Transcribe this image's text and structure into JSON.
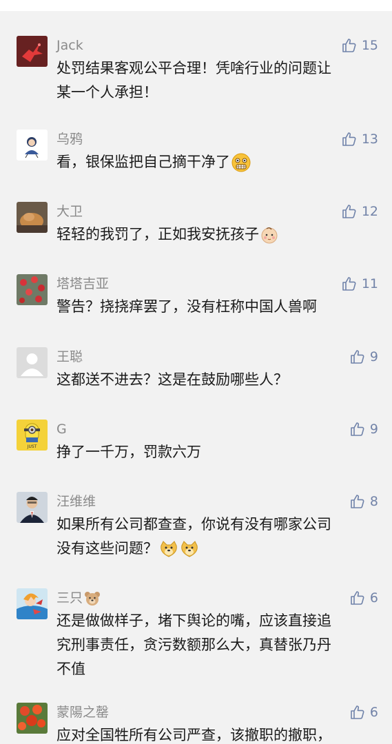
{
  "comments": [
    {
      "author": "Jack",
      "likes": "15",
      "lines": [
        "处罚结果客观公平合理！凭啥行业的问题让",
        "某一个人承担！"
      ],
      "avatar": "red-bird-avatar"
    },
    {
      "author": "乌鸦",
      "likes": "13",
      "lines": [
        "看，银保监把自己摘干净了"
      ],
      "emoji": "grimace-emoji",
      "avatar": "cartoon-person-avatar"
    },
    {
      "author": "大卫",
      "likes": "12",
      "lines": [
        "轻轻的我罚了，正如我安抚孩子"
      ],
      "emoji": "baby-emoji",
      "avatar": "cat-avatar"
    },
    {
      "author": "塔塔吉亚",
      "likes": "11",
      "lines": [
        "警告？挠挠痒罢了，没有枉称中国人兽啊"
      ],
      "avatar": "flowers-avatar"
    },
    {
      "author": "王聪",
      "likes": "9",
      "lines": [
        "这都送不进去？这是在鼓励哪些人？"
      ],
      "avatar": "default-user-avatar"
    },
    {
      "author": "G",
      "likes": "9",
      "lines": [
        "挣了一千万，罚款六万"
      ],
      "avatar": "minion-avatar"
    },
    {
      "author": "汪维维",
      "likes": "8",
      "lines": [
        "如果所有公司都查查，你说有没有哪家公司",
        "没有这些问题？"
      ],
      "emoji": "doge-emoji",
      "avatar": "man-in-suit-avatar"
    },
    {
      "author": "三只",
      "author_emoji": "bear-emoji",
      "likes": "6",
      "lines": [
        "还是做做样子，堵下舆论的嘴，应该直接追",
        "究刑事责任，贪污数额那么大，真替张乃丹",
        "不值"
      ],
      "avatar": "anime-avatar"
    },
    {
      "author": "蒙陽之罄",
      "likes": "6",
      "lines": [
        "应对全国牲所有公司严查，该撤职的撤职，"
      ],
      "avatar": "red-flowers-avatar"
    }
  ]
}
